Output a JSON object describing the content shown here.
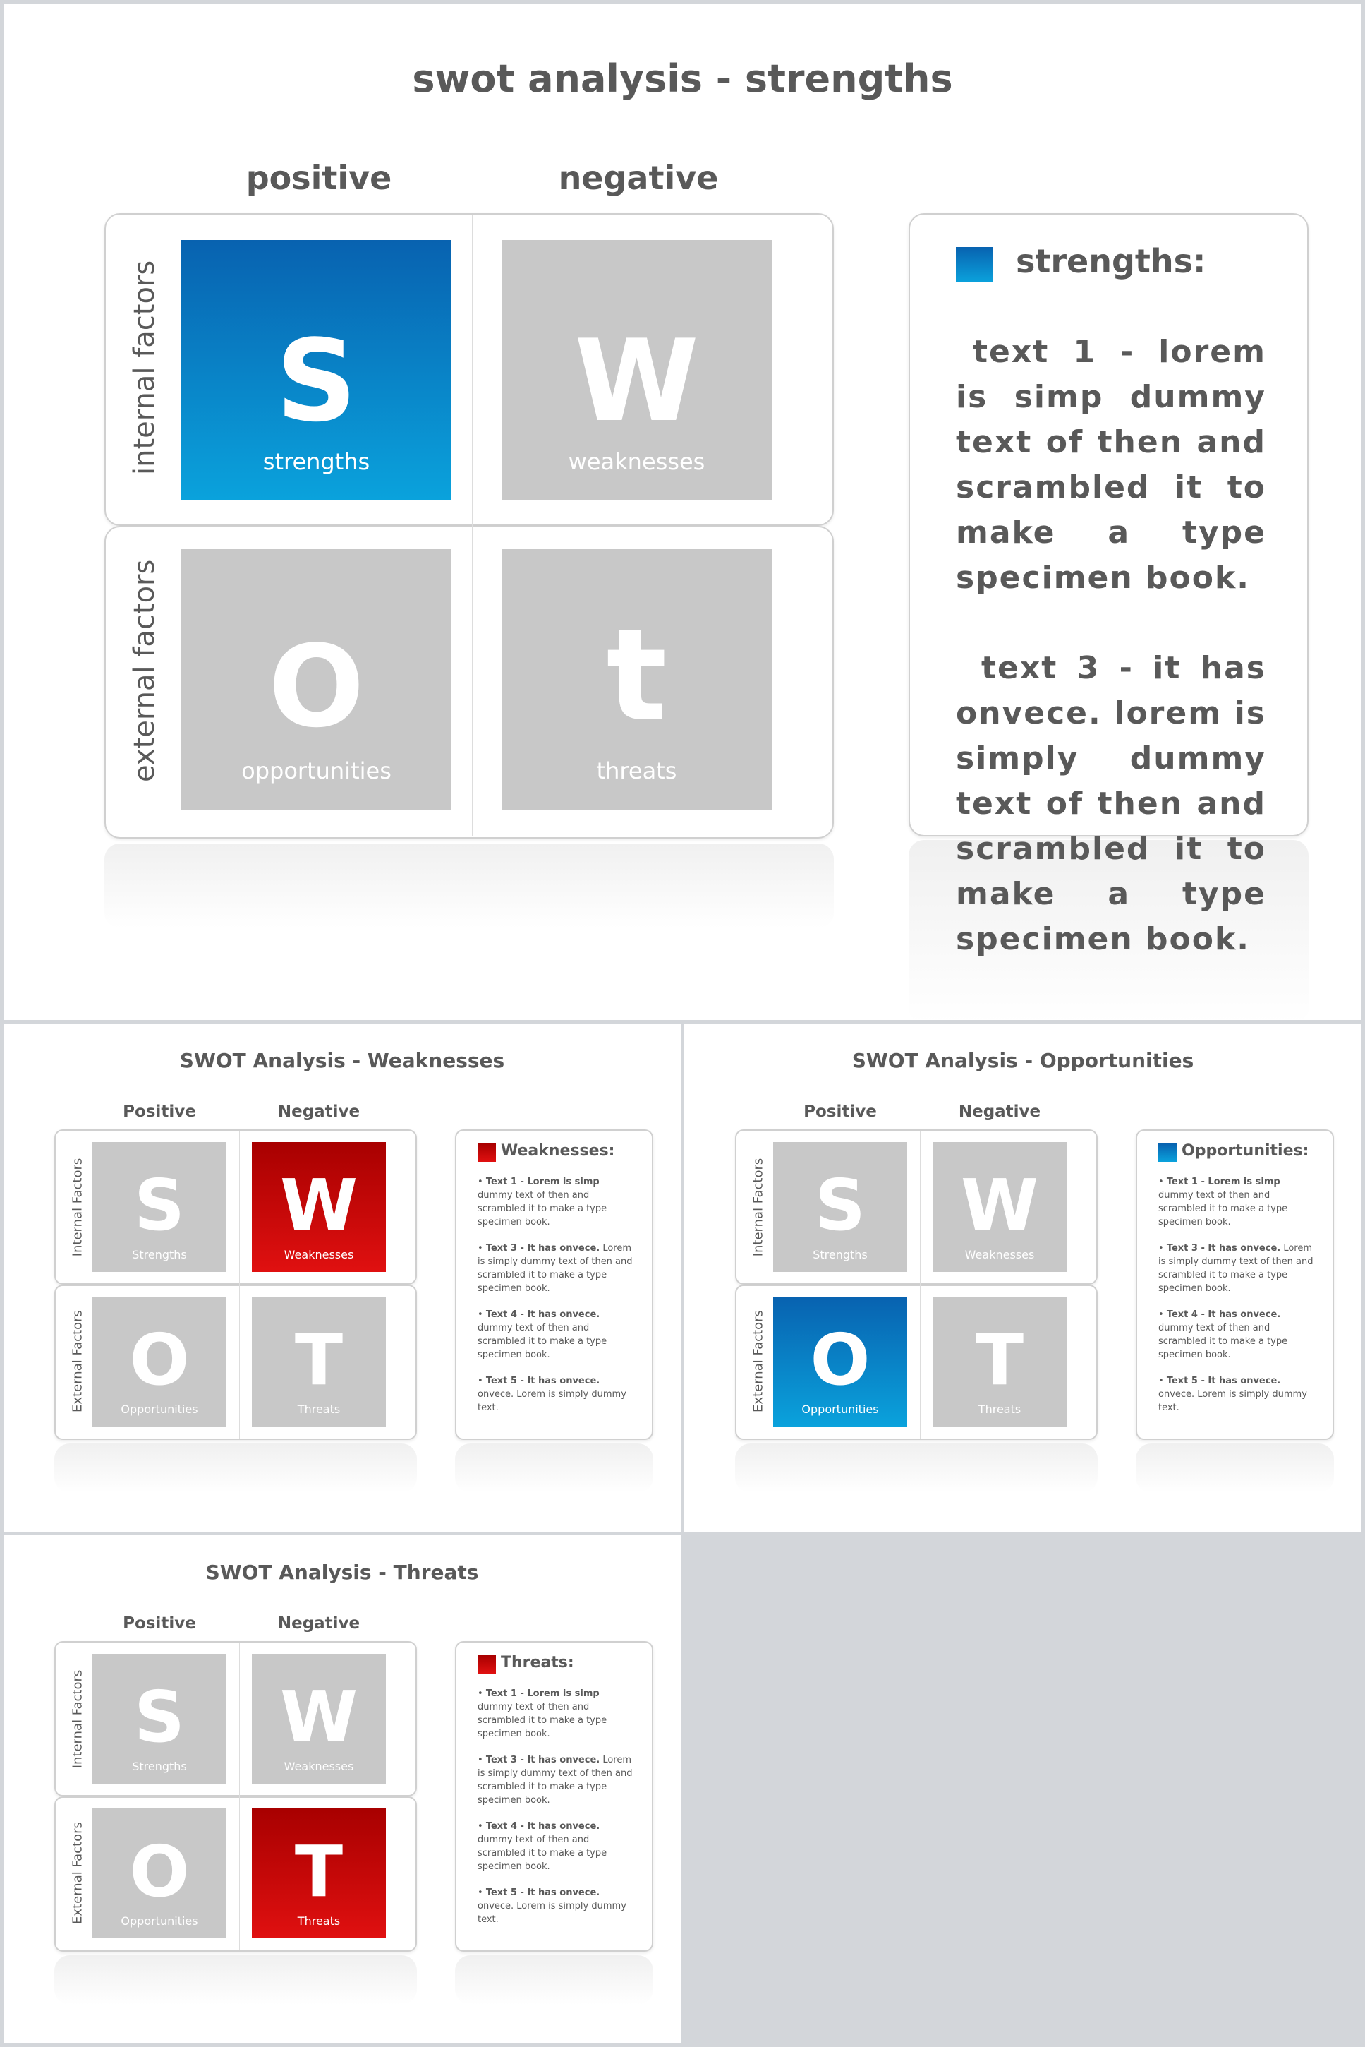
{
  "main": {
    "title": "swot analysis - strengths",
    "positive": "positive",
    "negative": "negative",
    "internal": "internal factors",
    "external": "external factors",
    "tiles": [
      {
        "letter": "S",
        "word": "strengths"
      },
      {
        "letter": "W",
        "word": "weaknesses"
      },
      {
        "letter": "O",
        "word": "opportunities"
      },
      {
        "letter": "t",
        "word": "threats"
      }
    ],
    "panel_title": "strengths:",
    "text1": "text 1 - lorem is simp dummy text of then and scrambled it to make a type specimen book.",
    "text3": "text 3 -  it has onvece. lorem is simply dummy text of then and scrambled it to make a type specimen book.",
    "accent": "#0a7bc8"
  },
  "slides": [
    {
      "title": "SWOT Analysis - Weaknesses",
      "panel_title": "Weaknesses:",
      "highlight": 1,
      "color": "red"
    },
    {
      "title": "SWOT Analysis - Opportunities",
      "panel_title": "Opportunities:",
      "highlight": 2,
      "color": "blue"
    },
    {
      "title": "SWOT Analysis - Threats",
      "panel_title": "Threats:",
      "highlight": 3,
      "color": "red"
    }
  ],
  "small": {
    "positive": "Positive",
    "negative": "Negative",
    "internal": "Internal Factors",
    "external": "External Factors",
    "tiles": [
      {
        "letter": "S",
        "word": "Strengths"
      },
      {
        "letter": "W",
        "word": "Weaknesses"
      },
      {
        "letter": "O",
        "word": "Opportunities"
      },
      {
        "letter": "T",
        "word": "Threats"
      }
    ],
    "bullets": [
      {
        "bold": "Text 1 - Lorem is simp",
        "rest": " dummy text of then and scrambled it to make a type specimen book."
      },
      {
        "bold": "Text 3 -  It has onvece.",
        "rest": " Lorem is simply dummy text of then and scrambled it to make a type specimen book."
      },
      {
        "bold": "Text 4 -  It has onvece.",
        "rest": " dummy text of then and scrambled it to make a type specimen book."
      },
      {
        "bold": "Text 5 -  It has onvece.",
        "rest": " onvece. Lorem is simply dummy text."
      }
    ]
  }
}
